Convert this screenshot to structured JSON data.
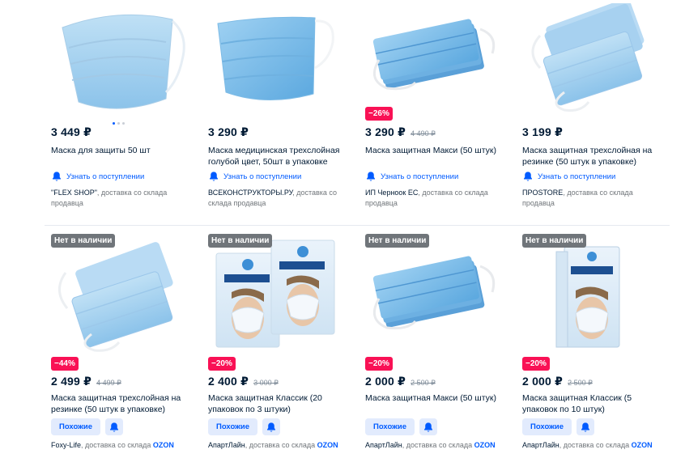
{
  "colors": {
    "accent": "#005bff",
    "discount": "#f91155",
    "out_of_stock": "#70757a",
    "price": "#001a34",
    "muted": "#70757a"
  },
  "products": [
    {
      "price": "3 449 ₽",
      "old_price": "",
      "discount": "",
      "title": "Маска для защиты 50 шт",
      "notify_label": "Узнать о поступлении",
      "seller": "\"FLEX SHOP\"",
      "delivery": ", доставка со склада продавца"
    },
    {
      "price": "3 290 ₽",
      "old_price": "",
      "discount": "",
      "title": "Маска медицинская трехслойная голубой цвет, 50шт в упаковке",
      "notify_label": "Узнать о поступлении",
      "seller": "ВСЕКОНСТРУКТОРЫ.РУ",
      "delivery": ", доставка со склада продавца"
    },
    {
      "price": "3 290 ₽",
      "old_price": "4 490 ₽",
      "discount": "−26%",
      "title": "Маска защитная Макси (50 штук)",
      "notify_label": "Узнать о поступлении",
      "seller": "ИП Черноок ЕС",
      "delivery": ", доставка со склада продавца"
    },
    {
      "price": "3 199 ₽",
      "old_price": "",
      "discount": "",
      "title": "Маска защитная трехслойная на резинке (50 штук в упаковке)",
      "notify_label": "Узнать о поступлении",
      "seller": "ПРOSTORE",
      "delivery": ", доставка со склада продавца"
    },
    {
      "stock": "Нет в наличии",
      "price": "2 499 ₽",
      "old_price": "4 499 ₽",
      "discount": "−44%",
      "title": "Маска защитная трехслойная на резинке (50 штук в упаковке)",
      "similar_label": "Похожие",
      "seller": "Foxy-Life",
      "delivery": ", доставка со склада ",
      "ozon": "OZON"
    },
    {
      "stock": "Нет в наличии",
      "price": "2 400 ₽",
      "old_price": "3 000 ₽",
      "discount": "−20%",
      "title": "Маска защитная Классик (20 упаковок по 3 штуки)",
      "similar_label": "Похожие",
      "seller": "АпартЛайн",
      "delivery": ", доставка со склада ",
      "ozon": "OZON"
    },
    {
      "stock": "Нет в наличии",
      "price": "2 000 ₽",
      "old_price": "2 500 ₽",
      "discount": "−20%",
      "title": "Маска защитная Макси (50 штук)",
      "similar_label": "Похожие",
      "seller": "АпартЛайн",
      "delivery": ", доставка со склада ",
      "ozon": "OZON"
    },
    {
      "stock": "Нет в наличии",
      "price": "2 000 ₽",
      "old_price": "2 500 ₽",
      "discount": "−20%",
      "title": "Маска защитная Классик (5 упаковок по 10 штук)",
      "similar_label": "Похожие",
      "seller": "АпартЛайн",
      "delivery": ", доставка со склада ",
      "ozon": "OZON"
    }
  ],
  "icons": {
    "notify": "bell-icon",
    "subscribe": "bell-icon"
  }
}
